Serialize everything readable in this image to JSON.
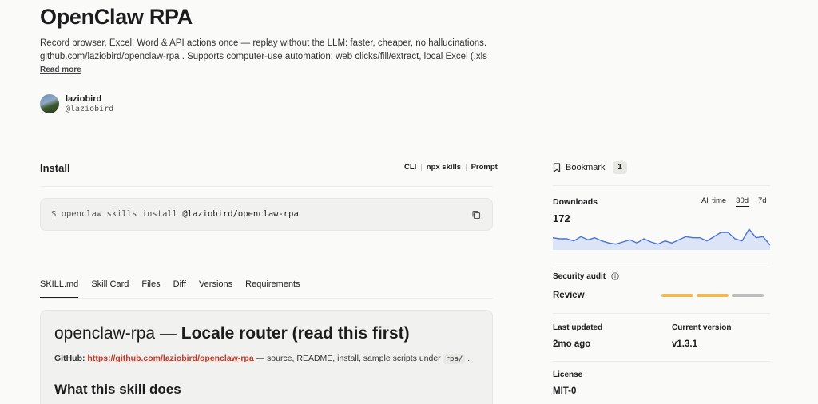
{
  "header": {
    "title": "OpenClaw RPA",
    "description_line1": "Record browser, Excel, Word & API actions once — replay without the LLM: faster, cheaper, no hallucinations.",
    "description_line2": "github.com/laziobird/openclaw-rpa . Supports computer-use automation: web clicks/fill/extract, local Excel (.xlsx via...",
    "read_more": "Read more"
  },
  "author": {
    "name": "laziobird",
    "handle": "@laziobird"
  },
  "install": {
    "label": "Install",
    "tabs": [
      "CLI",
      "npx skills",
      "Prompt"
    ],
    "command_prefix": "$ openclaw skills install ",
    "command_target": "@laziobird/openclaw-rpa"
  },
  "tabs": [
    "SKILL.md",
    "Skill Card",
    "Files",
    "Diff",
    "Versions",
    "Requirements"
  ],
  "skill_doc": {
    "heading_plain": "openclaw-rpa — ",
    "heading_strong": "Locale router (read this first)",
    "github_label": "GitHub:",
    "github_link": "https://github.com/laziobird/openclaw-rpa",
    "github_rest": " — source, README, install, sample scripts under ",
    "github_code": "rpa/",
    "github_end": " .",
    "section_heading": "What this skill does"
  },
  "sidebar": {
    "bookmark_label": "Bookmark",
    "bookmark_count": "1",
    "downloads_label": "Downloads",
    "ranges": [
      "All time",
      "30d",
      "7d"
    ],
    "active_range": "30d",
    "downloads_count": "172",
    "downloads_series": [
      10,
      9,
      9,
      7,
      11,
      8,
      10,
      7,
      5,
      4,
      6,
      8,
      5,
      9,
      6,
      4,
      7,
      5,
      8,
      11,
      10,
      10,
      7,
      11,
      15,
      15,
      9,
      7,
      18,
      10,
      11,
      3
    ],
    "security_label": "Security audit",
    "security_value": "Review",
    "security_bars": [
      "#f0b955",
      "#f0b955",
      "#bdbdbd"
    ],
    "last_updated_label": "Last updated",
    "last_updated_value": "2mo ago",
    "current_version_label": "Current version",
    "current_version_value": "v1.3.1",
    "license_label": "License",
    "license_value": "MIT-0"
  },
  "colors": {
    "spark_line": "#4a72d8",
    "spark_fill": "#dce5f8",
    "link": "#c0392b"
  }
}
